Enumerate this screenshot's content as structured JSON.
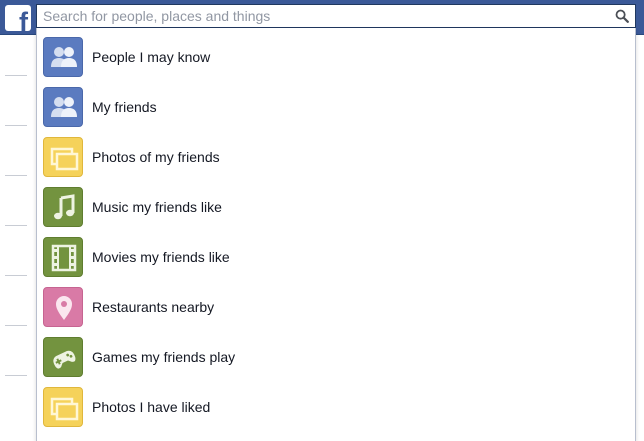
{
  "colors": {
    "brand": "#3b5998",
    "tile_blue": "#5b7bc0",
    "tile_yellow": "#f5d25a",
    "tile_green": "#73933f",
    "tile_pink": "#d97aa6"
  },
  "header": {
    "logo_letter": "f",
    "search": {
      "placeholder": "Search for people, places and things",
      "value": ""
    }
  },
  "suggestions": [
    {
      "label": "People I may know",
      "icon": "people-icon",
      "color": "blue"
    },
    {
      "label": "My friends",
      "icon": "people-icon",
      "color": "blue"
    },
    {
      "label": "Photos of my friends",
      "icon": "photos-icon",
      "color": "yellow"
    },
    {
      "label": "Music my friends like",
      "icon": "music-note-icon",
      "color": "green"
    },
    {
      "label": "Movies my friends like",
      "icon": "film-icon",
      "color": "green"
    },
    {
      "label": "Restaurants nearby",
      "icon": "map-pin-icon",
      "color": "pink"
    },
    {
      "label": "Games my friends play",
      "icon": "gamepad-icon",
      "color": "green"
    },
    {
      "label": "Photos I have liked",
      "icon": "photos-icon",
      "color": "yellow"
    }
  ]
}
